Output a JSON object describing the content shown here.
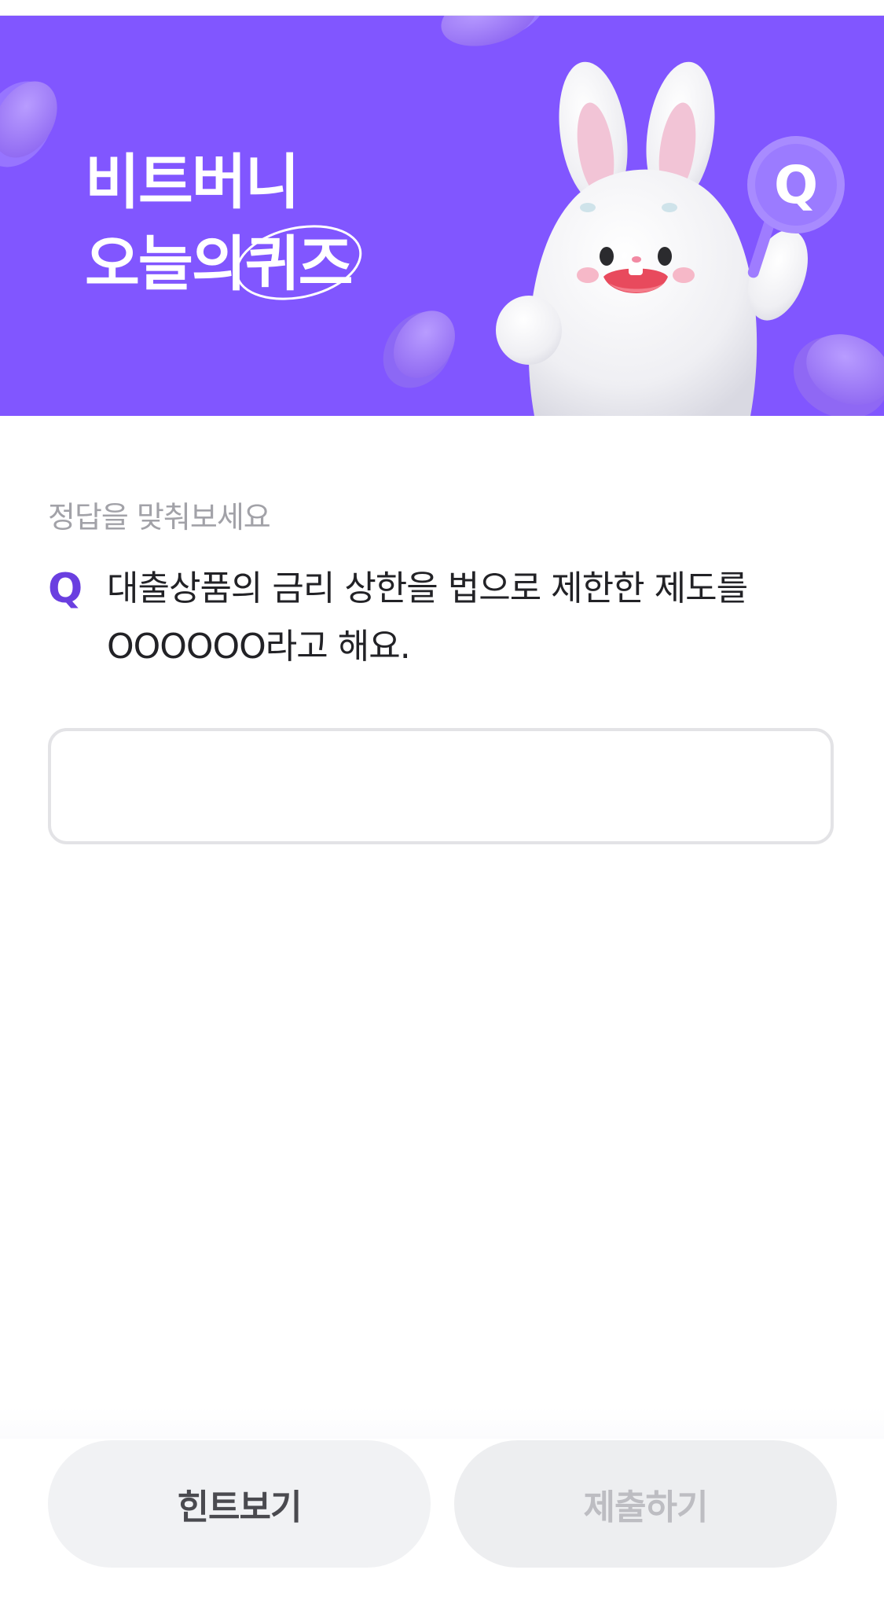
{
  "banner": {
    "title_line1": "비트버니",
    "title_line2_prefix": "오늘의",
    "title_line2_highlight": "퀴즈",
    "badge_letter": "Q",
    "background_color": "#8156ff",
    "character_icon": "bunny-mascot-icon"
  },
  "quiz": {
    "prompt": "정답을 맞춰보세요",
    "question_marker": "Q",
    "question_text": "대출상품의 금리 상한을 법으로 제한한 제도를 OOOOOO라고 해요.",
    "answer_value": "",
    "answer_placeholder": ""
  },
  "actions": {
    "hint_label": "힌트보기",
    "submit_label": "제출하기"
  },
  "colors": {
    "accent": "#6a3fe0",
    "disabled_text": "#bdbdc2"
  }
}
